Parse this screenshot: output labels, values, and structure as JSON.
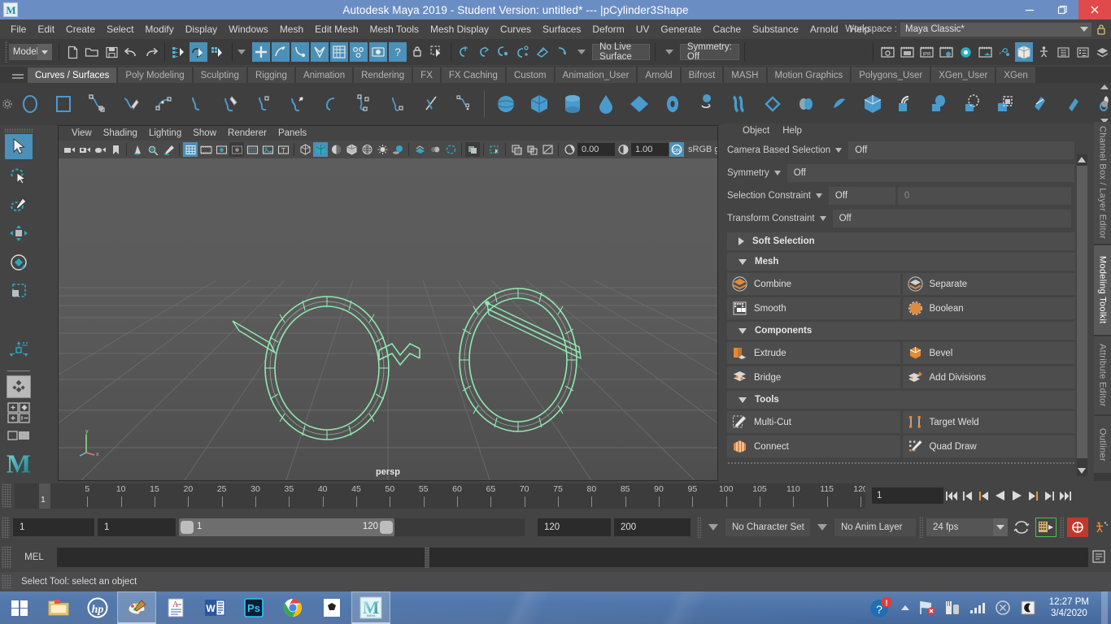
{
  "window": {
    "title": "Autodesk Maya 2019 - Student Version: untitled*   ---   |pCylinder3Shape",
    "app_icon": "maya-logo-icon",
    "minimize": "minimize-icon",
    "restore": "restore-icon",
    "close": "close-icon"
  },
  "menubar": {
    "items": [
      "File",
      "Edit",
      "Create",
      "Select",
      "Modify",
      "Display",
      "Windows",
      "Mesh",
      "Edit Mesh",
      "Mesh Tools",
      "Mesh Display",
      "Curves",
      "Surfaces",
      "Deform",
      "UV",
      "Generate",
      "Cache",
      "Substance",
      "Arnold",
      "Help"
    ],
    "workspace_label": "Workspace :",
    "workspace_value": "Maya Classic*",
    "lock_icon": "lock-icon"
  },
  "statusbar": {
    "mode": "Modeling",
    "live_surface": "No Live Surface",
    "symmetry": "Symmetry: Off",
    "icons": [
      "new-scene-icon",
      "open-scene-icon",
      "save-scene-icon",
      "undo-icon",
      "redo-icon",
      "select-hierarchy-icon",
      "select-object-icon",
      "select-component-icon",
      "snap-grid-icon",
      "snap-curve-icon",
      "snap-point-icon",
      "snap-projected-center-icon",
      "snap-view-plane-icon",
      "snap-orthogonal-icon",
      "lock-selection-icon",
      "render-view-icon",
      "ipr-render-icon",
      "render-settings-icon",
      "hypershade-icon",
      "render-setup-icon",
      "light-linking-icon",
      "modeling-toolkit-icon",
      "rig-icon",
      "attribute-editor-icon",
      "channel-box-icon",
      "layer-editor-icon"
    ]
  },
  "shelf": {
    "tabs": [
      "Curves / Surfaces",
      "Poly Modeling",
      "Sculpting",
      "Rigging",
      "Animation",
      "Rendering",
      "FX",
      "FX Caching",
      "Custom",
      "Animation_User",
      "Arnold",
      "Bifrost",
      "MASH",
      "Motion Graphics",
      "Polygons_User",
      "XGen_User",
      "XGen"
    ],
    "active_tab": "Curves / Surfaces",
    "buttons": [
      "nurbs-circle-icon",
      "nurbs-square-icon",
      "cv-curve-icon",
      "ep-curve-icon",
      "bezier-curve-icon",
      "pencil-curve-icon",
      "arc-three-point-icon",
      "two-point-arc-icon",
      "attach-curve-icon",
      "detach-curve-icon",
      "insert-knot-icon",
      "offset-curve-icon",
      "curve-fillet-icon",
      "cut-curve-icon",
      "rebuild-curve-icon",
      "nurbs-sphere-icon",
      "nurbs-cube-icon",
      "nurbs-cylinder-icon",
      "nurbs-cone-icon",
      "nurbs-plane-icon",
      "nurbs-torus-icon",
      "nurbs-circle-prim-icon",
      "nurbs-square-prim-icon",
      "revolve-icon",
      "loft-icon",
      "planar-icon",
      "extrude-surface-icon",
      "birail-icon",
      "boundary-icon",
      "square-surface-icon",
      "bevel-icon",
      "bevel-plus-icon",
      "intersect-surfaces-icon",
      "project-curve-icon",
      "trim-tool-icon",
      "untrim-icon",
      "attach-surfaces-icon",
      "sculpt-geometry-icon"
    ]
  },
  "toolbox": {
    "tools": [
      "select-tool",
      "lasso-select-tool",
      "paint-select-tool",
      "move-tool",
      "rotate-tool",
      "scale-tool",
      "last-tool-used",
      "soft-modification-tool",
      "four-view-layout-icon",
      "persp-outliner-layout-icon",
      "two-pane-layout-icon",
      "maya-logo-icon"
    ],
    "active": "select-tool"
  },
  "viewport": {
    "menus": [
      "View",
      "Shading",
      "Lighting",
      "Show",
      "Renderer",
      "Panels"
    ],
    "camera_label": "persp",
    "exposure": "0.00",
    "gamma": "1.00",
    "color_profile": "sRGB g",
    "gate_toggle": "ON",
    "toolbar_icons": [
      "camera-select-icon",
      "camera-lock-icon",
      "camera-attributes-icon",
      "bookmark-icon",
      "image-plane-icon",
      "2d-pan-zoom-icon",
      "paint-effects-icon",
      "grid-toggle-icon",
      "film-gate-icon",
      "resolution-gate-icon",
      "gate-mask-icon",
      "wireframe-on-shaded-icon",
      "xray-icon",
      "text-display-icon",
      "wireframe-icon",
      "smooth-shade-icon",
      "flat-shade-icon",
      "shaded-wire-icon",
      "textured-icon",
      "use-lights-icon",
      "shadows-icon",
      "ambient-occlusion-icon",
      "motion-blur-icon",
      "isolate-select-icon",
      "xray-joints-icon",
      "exposure-icon",
      "gamma-icon",
      "color-management-icon"
    ]
  },
  "right_panel": {
    "menus": [
      "Object",
      "Help"
    ],
    "settings": [
      {
        "label": "Camera Based Selection",
        "value": "Off",
        "extra": null
      },
      {
        "label": "Symmetry",
        "value": "Off",
        "extra": null
      },
      {
        "label": "Selection Constraint",
        "value": "Off",
        "extra": "0"
      },
      {
        "label": "Transform Constraint",
        "value": "Off",
        "extra": null
      }
    ],
    "sections": [
      {
        "title": "Soft Selection",
        "expanded": false,
        "items": []
      },
      {
        "title": "Mesh",
        "expanded": true,
        "items": [
          {
            "label": "Combine",
            "icon": "combine-icon"
          },
          {
            "label": "Separate",
            "icon": "separate-icon"
          },
          {
            "label": "Smooth",
            "icon": "smooth-icon"
          },
          {
            "label": "Boolean",
            "icon": "boolean-icon"
          }
        ]
      },
      {
        "title": "Components",
        "expanded": true,
        "items": [
          {
            "label": "Extrude",
            "icon": "extrude-icon"
          },
          {
            "label": "Bevel",
            "icon": "bevel-icon"
          },
          {
            "label": "Bridge",
            "icon": "bridge-icon"
          },
          {
            "label": "Add Divisions",
            "icon": "add-divisions-icon"
          }
        ]
      },
      {
        "title": "Tools",
        "expanded": true,
        "items": [
          {
            "label": "Multi-Cut",
            "icon": "multi-cut-icon"
          },
          {
            "label": "Target Weld",
            "icon": "target-weld-icon"
          },
          {
            "label": "Connect",
            "icon": "connect-icon"
          },
          {
            "label": "Quad Draw",
            "icon": "quad-draw-icon"
          }
        ]
      }
    ]
  },
  "vertical_tabs": {
    "items": [
      "Channel Box / Layer Editor",
      "Modeling Toolkit",
      "Attribute Editor",
      "Outliner"
    ],
    "active": "Modeling Toolkit"
  },
  "timeline": {
    "ticks": [
      5,
      10,
      15,
      20,
      25,
      30,
      35,
      40,
      45,
      50,
      55,
      60,
      65,
      70,
      75,
      80,
      85,
      90,
      95,
      100,
      105,
      110,
      115,
      120
    ],
    "playhead_frame": "1",
    "current_frame": "1",
    "transport": [
      "go-to-start-icon",
      "step-back-keyframe-icon",
      "step-back-frame-icon",
      "play-backwards-icon",
      "play-forwards-icon",
      "step-forward-frame-icon",
      "step-forward-keyframe-icon",
      "go-to-end-icon"
    ]
  },
  "range": {
    "anim_start": "1",
    "range_start": "1",
    "slider_min": "1",
    "slider_max": "120",
    "range_end": "120",
    "anim_end": "200",
    "character_set": "No Character Set",
    "anim_layer": "No Anim Layer",
    "fps": "24 fps",
    "auto_key_icon": "auto-key-icon",
    "anim_prefs_icon": "animation-preferences-icon",
    "cycle_icon": "playback-loop-icon",
    "key_icon": "key-anim-icon"
  },
  "command_line": {
    "language": "MEL",
    "input_value": "",
    "output_value": "",
    "script_editor_icon": "script-editor-icon"
  },
  "help_line": {
    "text": "Select Tool: select an object"
  },
  "taskbar": {
    "start": "windows-start-icon",
    "items": [
      "file-explorer-icon",
      "hp-icon",
      "paint-icon",
      "wordpad-icon",
      "word-icon",
      "photoshop-icon",
      "chrome-icon",
      "unity-icon",
      "maya-icon"
    ],
    "active_items": [
      "paint-icon",
      "maya-icon"
    ],
    "tray": [
      "help-alert-icon",
      "show-hidden-icons-icon",
      "network-icon",
      "antivirus-icon",
      "volume-icon",
      "action-center-icon",
      "night-mode-icon"
    ],
    "time": "12:27 PM",
    "date": "3/4/2020"
  },
  "colors": {
    "title_bar": "#6a8ec4",
    "close_button": "#e04a4a",
    "accent_blue": "#4a90b8",
    "panel_bg": "#444444",
    "viewport_bg": "#5a5a5a",
    "mesh_highlight": "#8fe8b0",
    "orange_icon": "#e08a3c"
  }
}
